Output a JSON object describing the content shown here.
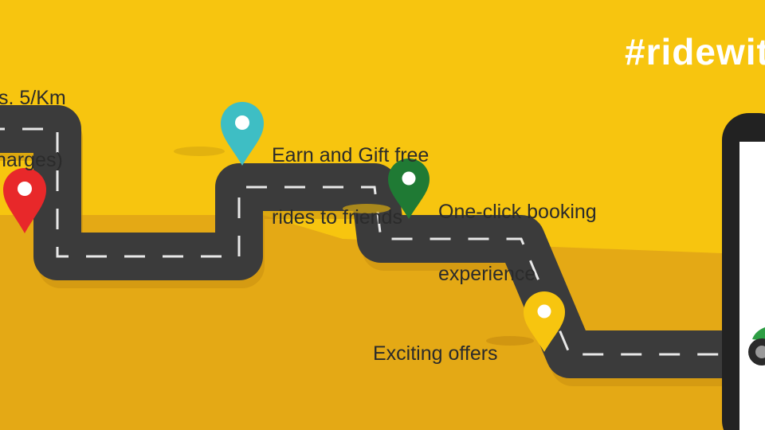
{
  "hashtag": "#ridewit",
  "features": {
    "rate": {
      "line1": "s. 5/Km",
      "line2": "harges)"
    },
    "earn_gift": {
      "line1": "Earn and Gift free",
      "line2": "rides to friends"
    },
    "one_click": {
      "line1": "One-click booking",
      "line2": "experience"
    },
    "offers": {
      "line1": "Exciting offers"
    }
  },
  "colors": {
    "background_top": "#f7c50f",
    "background_bottom": "#e4a915",
    "road": "#3b3b3b",
    "road_dash": "#e8e8e8",
    "pin_red": "#e8282a",
    "pin_teal": "#3ebec4",
    "pin_green": "#1f7a34",
    "pin_yellow": "#f7c50f",
    "phone_body": "#222222",
    "phone_screen": "#ffffff",
    "hashtag": "#ffffff"
  },
  "icons": [
    "map-pin-icon",
    "phone-icon",
    "scooter-icon"
  ]
}
